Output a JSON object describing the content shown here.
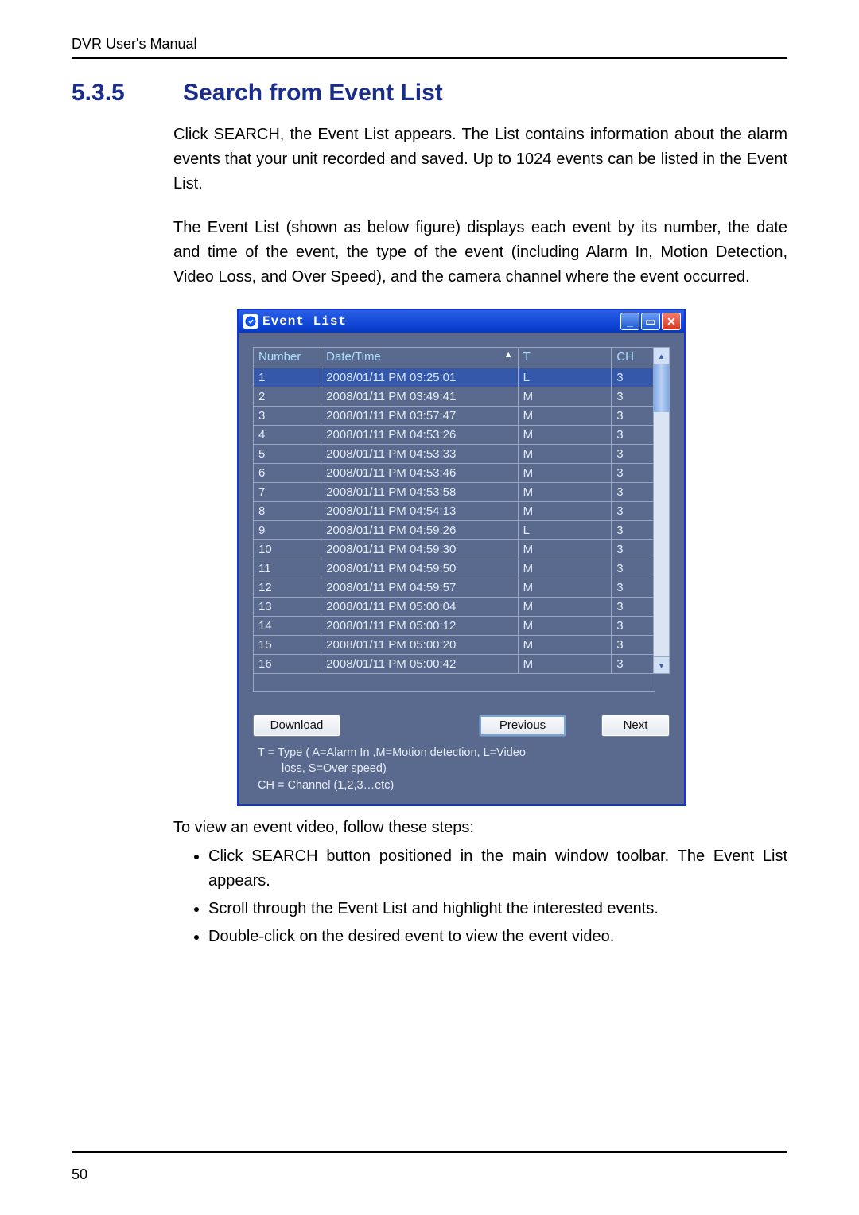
{
  "doc": {
    "header": "DVR User's Manual",
    "section_number": "5.3.5",
    "section_title": "Search from Event List",
    "para1": "Click SEARCH, the Event List appears. The List contains information about the alarm events that your unit recorded and saved. Up to 1024 events can be listed in the Event List.",
    "para2": "The Event List (shown as below figure) displays each event by its number, the date and time of the event, the type of the event (including Alarm In, Motion Detection, Video Loss, and Over Speed), and the camera channel where the event occurred.",
    "post_fig": "To view an event video, follow these steps:",
    "steps": [
      "Click SEARCH button positioned in the main window toolbar. The Event List appears.",
      "Scroll through the Event List and highlight the interested events.",
      "Double-click on the desired event to view the event video."
    ],
    "page_number": "50"
  },
  "window": {
    "title": "Event List",
    "columns": {
      "number": "Number",
      "datetime": "Date/Time",
      "type": "T",
      "channel": "CH"
    },
    "rows": [
      {
        "n": "1",
        "dt": "2008/01/11 PM 03:25:01",
        "t": "L",
        "ch": "3",
        "selected": true
      },
      {
        "n": "2",
        "dt": "2008/01/11 PM 03:49:41",
        "t": "M",
        "ch": "3"
      },
      {
        "n": "3",
        "dt": "2008/01/11 PM 03:57:47",
        "t": "M",
        "ch": "3"
      },
      {
        "n": "4",
        "dt": "2008/01/11 PM 04:53:26",
        "t": "M",
        "ch": "3"
      },
      {
        "n": "5",
        "dt": "2008/01/11 PM 04:53:33",
        "t": "M",
        "ch": "3"
      },
      {
        "n": "6",
        "dt": "2008/01/11 PM 04:53:46",
        "t": "M",
        "ch": "3"
      },
      {
        "n": "7",
        "dt": "2008/01/11 PM 04:53:58",
        "t": "M",
        "ch": "3"
      },
      {
        "n": "8",
        "dt": "2008/01/11 PM 04:54:13",
        "t": "M",
        "ch": "3"
      },
      {
        "n": "9",
        "dt": "2008/01/11 PM 04:59:26",
        "t": "L",
        "ch": "3"
      },
      {
        "n": "10",
        "dt": "2008/01/11 PM 04:59:30",
        "t": "M",
        "ch": "3"
      },
      {
        "n": "11",
        "dt": "2008/01/11 PM 04:59:50",
        "t": "M",
        "ch": "3"
      },
      {
        "n": "12",
        "dt": "2008/01/11 PM 04:59:57",
        "t": "M",
        "ch": "3"
      },
      {
        "n": "13",
        "dt": "2008/01/11 PM 05:00:04",
        "t": "M",
        "ch": "3"
      },
      {
        "n": "14",
        "dt": "2008/01/11 PM 05:00:12",
        "t": "M",
        "ch": "3"
      },
      {
        "n": "15",
        "dt": "2008/01/11 PM 05:00:20",
        "t": "M",
        "ch": "3"
      },
      {
        "n": "16",
        "dt": "2008/01/11 PM 05:00:42",
        "t": "M",
        "ch": "3"
      }
    ],
    "buttons": {
      "download": "Download",
      "previous": "Previous",
      "next": "Next"
    },
    "legend_line1": "T = Type ( A=Alarm In ,M=Motion detection, L=Video",
    "legend_line1b": "loss, S=Over speed)",
    "legend_line2": "CH = Channel (1,2,3…etc)"
  }
}
